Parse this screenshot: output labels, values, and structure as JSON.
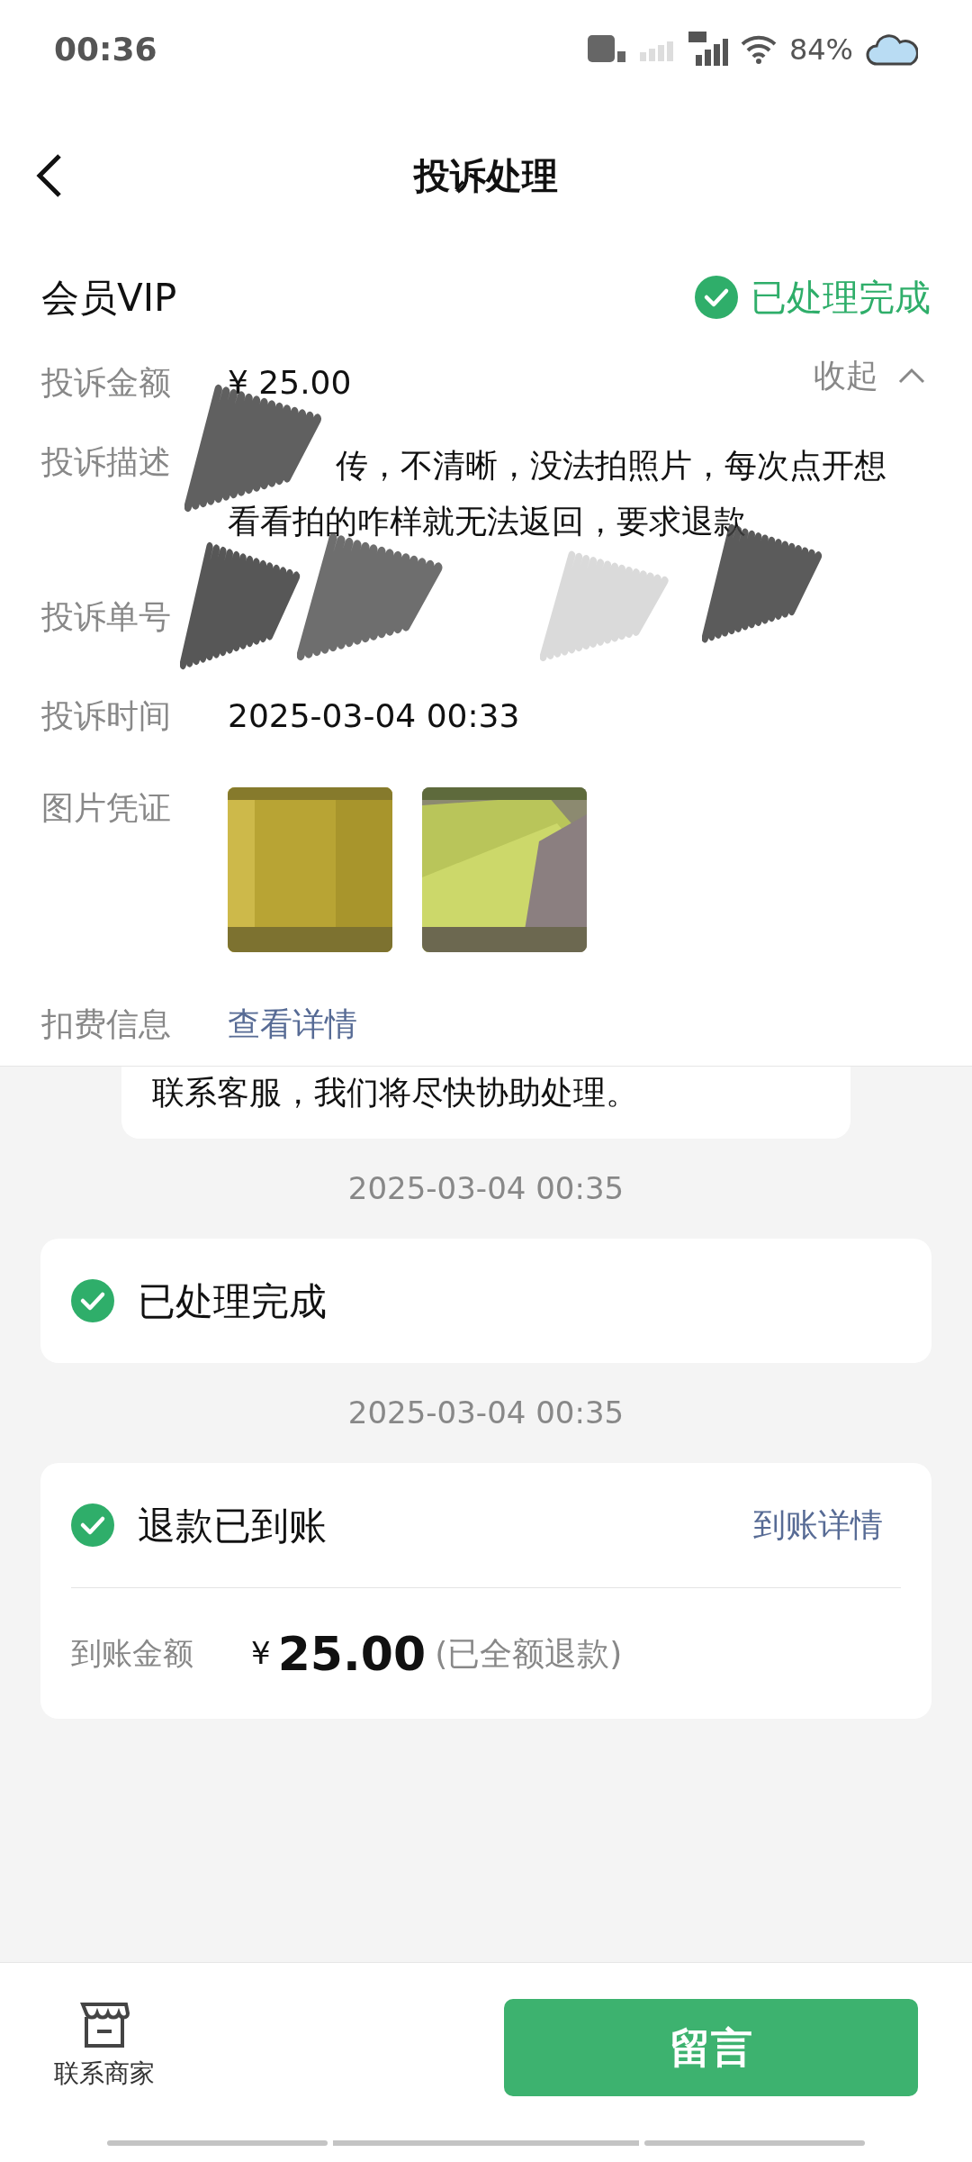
{
  "status_bar": {
    "time": "00:36",
    "battery": "84%"
  },
  "header": {
    "title": "投诉处理"
  },
  "complaint": {
    "product": "会员VIP",
    "status": "已处理完成",
    "collapse": "收起",
    "rows": [
      {
        "kind": "text",
        "label": "投诉金额",
        "value": "¥ 25.00"
      },
      {
        "kind": "lines",
        "label": "投诉描述",
        "lines": [
          "传，不清晰，没法拍照片，每次点开想",
          "看看拍的咋样就无法返回，要求退款"
        ]
      },
      {
        "kind": "hidden",
        "label": "投诉单号"
      },
      {
        "kind": "text",
        "label": "投诉时间",
        "value": "2025-03-04 00:33"
      },
      {
        "kind": "photos",
        "label": "图片凭证"
      },
      {
        "kind": "link",
        "label": "扣费信息",
        "value": "查看详情"
      }
    ]
  },
  "timeline": {
    "partial_message": "联系客服，我们将尽快协助处理。",
    "events": [
      {
        "time": "2025-03-04 00:35",
        "title": "已处理完成"
      },
      {
        "time": "2025-03-04 00:35",
        "title": "退款已到账",
        "link": "到账详情",
        "amount_label": "到账金额",
        "currency": "¥",
        "amount": "25.00",
        "note": "(已全额退款)"
      }
    ]
  },
  "bottom_bar": {
    "contact": "联系商家",
    "button": "留言"
  }
}
